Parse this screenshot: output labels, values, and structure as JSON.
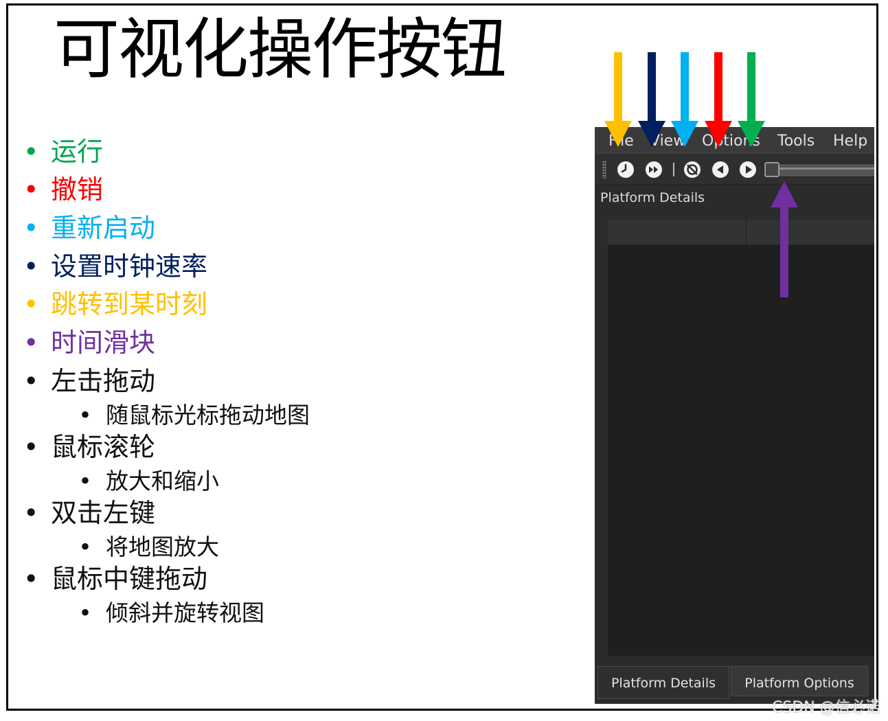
{
  "slide": {
    "title": "可视化操作按钮",
    "bullets": [
      {
        "text": "运行",
        "color": "#00a651"
      },
      {
        "text": "撤销",
        "color": "#ff0000"
      },
      {
        "text": "重新启动",
        "color": "#00b0f0"
      },
      {
        "text": "设置时钟速率",
        "color": "#002060"
      },
      {
        "text": "跳转到某时刻",
        "color": "#ffc000"
      },
      {
        "text": "时间滑块",
        "color": "#7030a0"
      },
      {
        "text": "左击拖动",
        "color": "#111111",
        "sub": "随鼠标光标拖动地图"
      },
      {
        "text": "鼠标滚轮",
        "color": "#111111",
        "sub": "放大和缩小"
      },
      {
        "text": "双击左键",
        "color": "#111111",
        "sub": "将地图放大"
      },
      {
        "text": "鼠标中键拖动",
        "color": "#111111",
        "sub": "倾斜并旋转视图"
      }
    ],
    "bullet_glyph": "•"
  },
  "app": {
    "menu": [
      "File",
      "View",
      "Options",
      "Tools",
      "Help"
    ],
    "toolbar_icons": [
      "clock-icon",
      "fast-forward-icon",
      "restart-icon",
      "step-back-icon",
      "play-icon"
    ],
    "panel_title": "Platform Details",
    "tabs": [
      "Platform Details",
      "Platform Options"
    ]
  },
  "arrows": {
    "colors": [
      "#ffc000",
      "#002060",
      "#00b0f0",
      "#ff0000",
      "#00b050",
      "#7030a0"
    ]
  },
  "watermark": "CSDN @信必诺"
}
